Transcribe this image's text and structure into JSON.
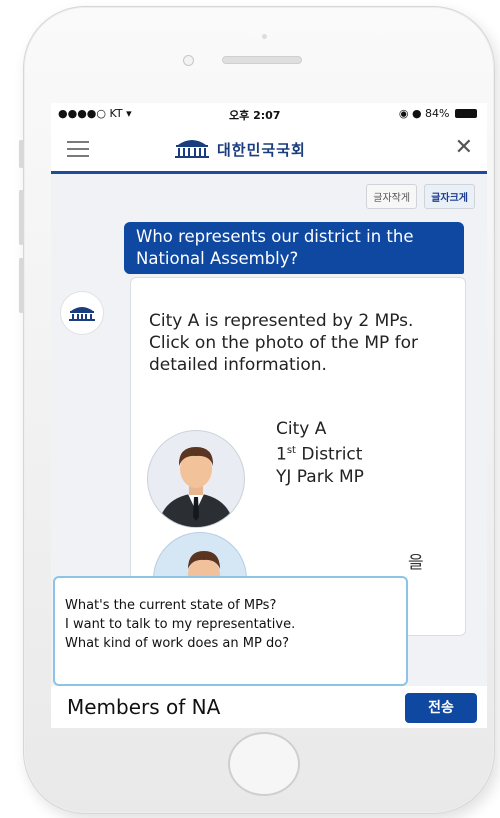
{
  "status_bar": {
    "carrier": "●●●●○ KT",
    "time": "오후 2:07",
    "battery": "84%"
  },
  "header": {
    "logo_text": "대한민국국회"
  },
  "font_controls": {
    "small_label": "글자작게",
    "large_label": "글자크게"
  },
  "chat": {
    "user_message": "Who represents our district in the National Assembly?",
    "bot_message": "City A is represented by 2 MPs. Click on the photo of the MP for detailed information.",
    "mp": {
      "city": "City A",
      "district_number": "1",
      "district_suffix": "st",
      "district_word": "District",
      "name": "YJ Park MP"
    },
    "partial_text": "을"
  },
  "suggestions": [
    "What's the current state of MPs?",
    "I want to talk to my representative.",
    "What kind of work does an MP do?"
  ],
  "input": {
    "value": "Members of NA"
  },
  "send_label": "전송",
  "colors": {
    "brand_blue": "#0e48a0",
    "header_rule": "#1c4d9a",
    "suggest_border": "#8cc3e6"
  }
}
